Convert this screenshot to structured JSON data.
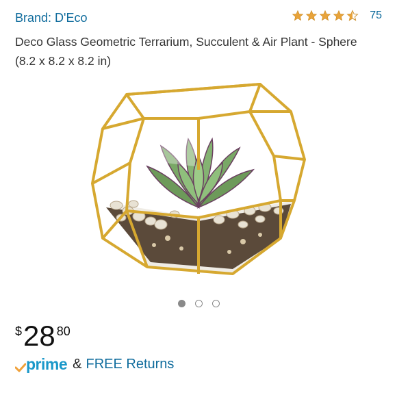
{
  "header": {
    "brand_label": "Brand: D'Eco",
    "rating": 4.5,
    "rating_color": "#e8a33a",
    "review_count": "75"
  },
  "product": {
    "title": "Deco Glass Geometric Terrarium, Succulent & Air Plant - Sphere (8.2 x 8.2 x 8.2 in)",
    "image_icon": "terrarium-product-image"
  },
  "carousel": {
    "total": 3,
    "active_index": 0
  },
  "price": {
    "currency": "$",
    "whole": "28",
    "fraction": "80"
  },
  "shipping": {
    "prime_label": "prime",
    "amp": "&",
    "returns_label": "FREE Returns",
    "prime_color": "#1a98c9",
    "check_color": "#f0a13a"
  }
}
